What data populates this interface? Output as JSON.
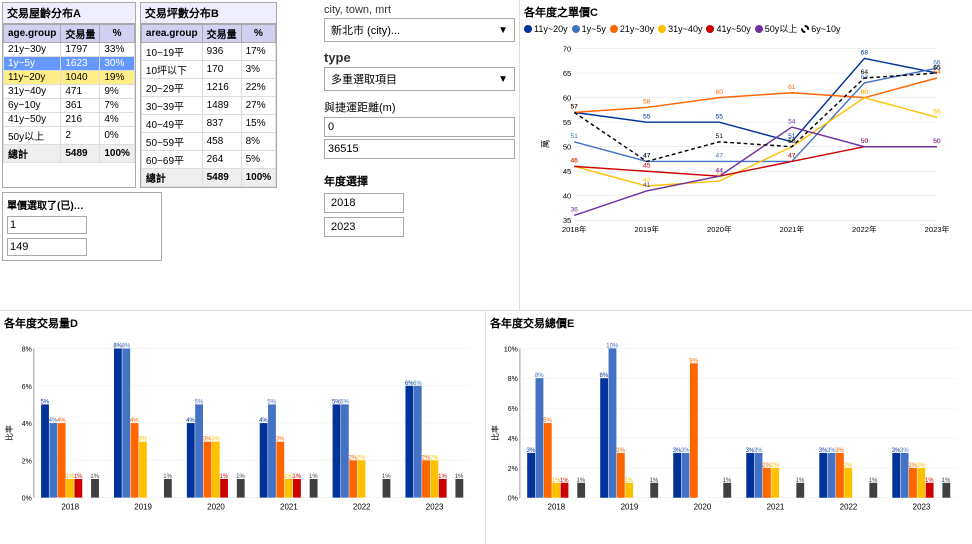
{
  "tableA": {
    "title": "交易屋齡分布A",
    "headers": [
      "age.group",
      "交易量",
      "%"
    ],
    "rows": [
      [
        "21y~30y",
        "1797",
        "33%",
        ""
      ],
      [
        "1y~5y",
        "1623",
        "30%",
        "highlight-blue"
      ],
      [
        "11y~20y",
        "1040",
        "19%",
        "highlight-yellow"
      ],
      [
        "31y~40y",
        "471",
        "9%",
        ""
      ],
      [
        "6y~10y",
        "361",
        "7%",
        ""
      ],
      [
        "41y~50y",
        "216",
        "4%",
        ""
      ],
      [
        "50y以上",
        "2",
        "0%",
        ""
      ],
      [
        "總計",
        "5489",
        "100%",
        "total"
      ]
    ]
  },
  "tableB": {
    "title": "交易坪數分布B",
    "headers": [
      "area.group",
      "交易量",
      "%"
    ],
    "rows": [
      [
        "10~19平",
        "936",
        "17%",
        ""
      ],
      [
        "10坪以下",
        "170",
        "3%",
        ""
      ],
      [
        "20~29平",
        "1216",
        "22%",
        ""
      ],
      [
        "30~39平",
        "1489",
        "27%",
        ""
      ],
      [
        "40~49平",
        "837",
        "15%",
        ""
      ],
      [
        "50~59平",
        "458",
        "8%",
        ""
      ],
      [
        "60~69平",
        "264",
        "5%",
        ""
      ],
      [
        "總計",
        "5489",
        "100%",
        "total"
      ]
    ]
  },
  "singlePrice": {
    "title": "單價選取了(已)…",
    "value1": "1",
    "value2": "149"
  },
  "filters": {
    "cityLabel": "city, town, mrt",
    "cityValue": "新北市 (city)...",
    "typeLabel": "type",
    "typeMultiLabel": "多重選取項目",
    "mrtLabel": "與捷運距離(m)",
    "mrtValue1": "0",
    "mrtValue2": "36515",
    "yearLabel": "年度選擇",
    "year1": "2018",
    "year2": "2023"
  },
  "chartC": {
    "title": "各年度之單價C",
    "legend": [
      {
        "label": "11y~20y",
        "color": "#003399"
      },
      {
        "label": "1y~5y",
        "color": "#4472C4"
      },
      {
        "label": "21y~30y",
        "color": "#FF6600"
      },
      {
        "label": "31y~40y",
        "color": "#FFC000"
      },
      {
        "label": "41y~50y",
        "color": "#CC0000"
      },
      {
        "label": "50y以上",
        "color": "#7030A0"
      },
      {
        "label": "6y~10y",
        "color": "#000000",
        "dashed": true
      }
    ],
    "years": [
      "2018年",
      "2019年",
      "2020年",
      "2021年",
      "2022年",
      "2023年"
    ],
    "series": [
      {
        "key": "11y~20y",
        "color": "#003399",
        "values": [
          57,
          55,
          55,
          51,
          68,
          65
        ]
      },
      {
        "key": "1y~5y",
        "color": "#4472C4",
        "values": [
          51,
          47,
          47,
          47,
          63,
          66
        ]
      },
      {
        "key": "21y~30y",
        "color": "#FF6600",
        "values": [
          57,
          58,
          60,
          61,
          60,
          64
        ]
      },
      {
        "key": "31y~40y",
        "color": "#FFC000",
        "values": [
          46,
          42,
          43,
          50,
          60,
          56
        ]
      },
      {
        "key": "41y~50y",
        "color": "#CC0000",
        "values": [
          46,
          45,
          44,
          47,
          50,
          50
        ]
      },
      {
        "key": "50y以上",
        "color": "#7030A0",
        "values": [
          36,
          41,
          44,
          54,
          50,
          50
        ]
      },
      {
        "key": "6y~10y",
        "color": "#000000",
        "dashed": true,
        "values": [
          57,
          47,
          51,
          50,
          64,
          65
        ]
      }
    ],
    "yMin": 35,
    "yMax": 70,
    "yLabel": "萬"
  },
  "chartD": {
    "title": "各年度交易量D",
    "yLabel": "比率",
    "years": [
      "2018",
      "2019",
      "2020",
      "2021",
      "2022",
      "2023"
    ],
    "categories": [
      "11y~20y",
      "1y~5y",
      "21y~30y",
      "31y~40y",
      "41y~50y",
      "50y以上",
      "6y~10y"
    ],
    "colors": [
      "#003399",
      "#4472C4",
      "#FF6600",
      "#FFC000",
      "#CC0000",
      "#7030A0",
      "#404040"
    ],
    "data": [
      [
        5,
        8,
        4,
        4,
        5,
        6
      ],
      [
        4,
        8,
        5,
        5,
        5,
        6
      ],
      [
        4,
        4,
        3,
        3,
        2,
        2
      ],
      [
        1,
        3,
        3,
        1,
        2,
        2
      ],
      [
        1,
        0,
        1,
        1,
        0,
        1
      ],
      [
        0,
        0,
        0,
        0,
        0,
        0
      ],
      [
        1,
        1,
        1,
        1,
        1,
        1
      ]
    ],
    "maxPct": 8
  },
  "chartE": {
    "title": "各年度交易總價E",
    "yLabel": "比率",
    "years": [
      "2018",
      "2019",
      "2020",
      "2021",
      "2022",
      "2023"
    ],
    "categories": [
      "11y~20y",
      "1y~5y",
      "21y~30y",
      "31y~40y",
      "41y~50y",
      "50y以上",
      "6y~10y"
    ],
    "colors": [
      "#003399",
      "#4472C4",
      "#FF6600",
      "#FFC000",
      "#CC0000",
      "#7030A0",
      "#404040"
    ],
    "data": [
      [
        3,
        8,
        3,
        3,
        3,
        3
      ],
      [
        8,
        10,
        3,
        3,
        3,
        3
      ],
      [
        5,
        3,
        9,
        2,
        3,
        2
      ],
      [
        1,
        1,
        0,
        2,
        2,
        2
      ],
      [
        1,
        0,
        0,
        0,
        0,
        1
      ],
      [
        0,
        0,
        0,
        0,
        0,
        0
      ],
      [
        1,
        1,
        1,
        1,
        1,
        1
      ]
    ],
    "maxPct": 10
  }
}
